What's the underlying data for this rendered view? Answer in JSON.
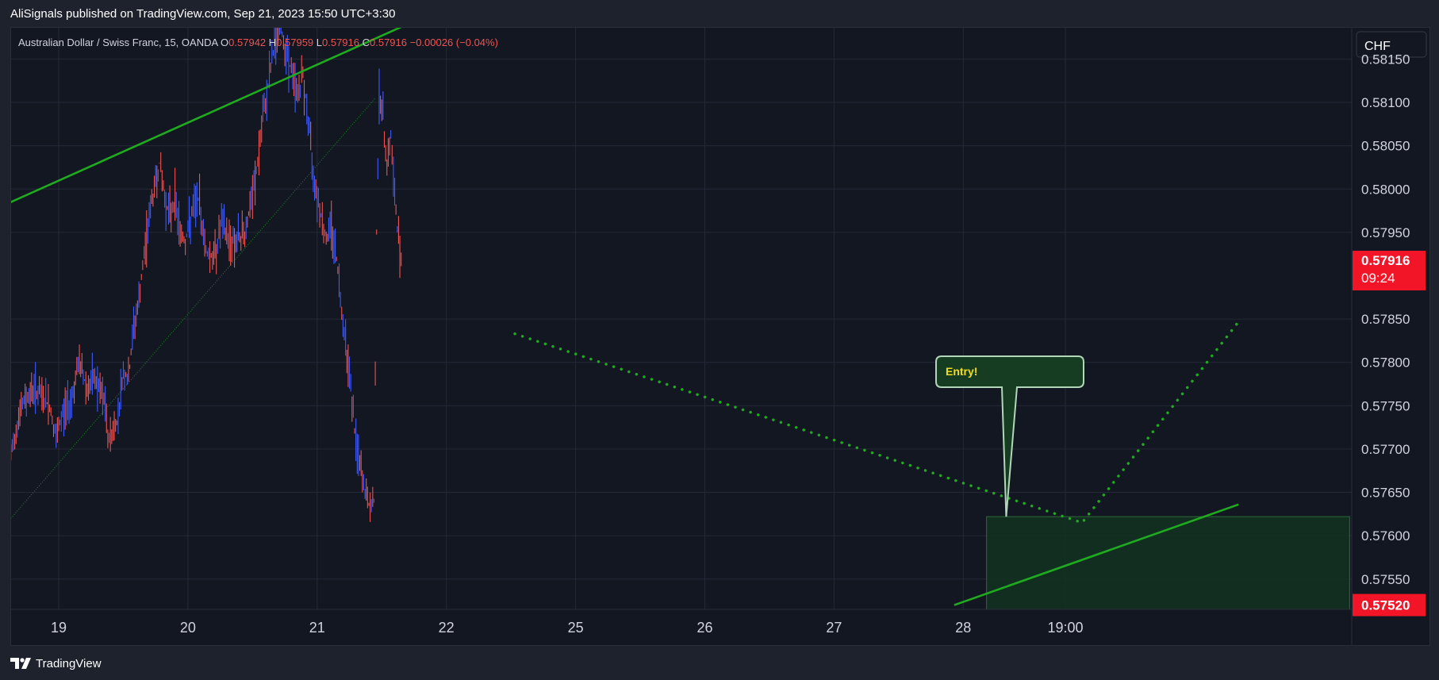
{
  "header": {
    "published_by": "AliSignals published on TradingView.com, Sep 21, 2023 15:50 UTC+3:30"
  },
  "footer": {
    "brand": "TradingView"
  },
  "colors": {
    "background": "#131722",
    "grid": "#242937",
    "up_candle": "#3d5afe",
    "down_candle": "#ef5350",
    "trendline": "#1faa1f",
    "price_tag": "#f21528",
    "callout_fill": "#163d21",
    "callout_border": "#b2d6b8",
    "callout_text": "#f2dc1f",
    "zone_fill": "#123320"
  },
  "chart_data": {
    "type": "line",
    "symbol": "Australian Dollar / Swiss Franc, 15, OANDA",
    "ohlc": {
      "o_label": "O",
      "o": "0.57942",
      "h_label": "H",
      "h": "0.57959",
      "l_label": "L",
      "l": "0.57916",
      "c_label": "C",
      "c": "0.57916",
      "change": "−0.00026 (−0.04%)"
    },
    "currency_button": "CHF",
    "y_axis": {
      "ticks": [
        "0.58150",
        "0.58100",
        "0.58050",
        "0.58000",
        "0.57950",
        "0.57850",
        "0.57800",
        "0.57750",
        "0.57700",
        "0.57650",
        "0.57600",
        "0.57550"
      ],
      "tick_values": [
        0.5815,
        0.581,
        0.5805,
        0.58,
        0.5795,
        0.5785,
        0.578,
        0.5775,
        0.577,
        0.5765,
        0.576,
        0.5755
      ],
      "range": [
        0.57515,
        0.58187
      ]
    },
    "x_axis": {
      "ticks": [
        "19",
        "20",
        "21",
        "22",
        "25",
        "26",
        "27",
        "28",
        "19:00"
      ],
      "tick_positions": [
        0,
        1,
        2,
        3,
        4,
        5,
        6,
        7,
        7.79
      ]
    },
    "current_price": {
      "label": "0.57916",
      "countdown": "09:24",
      "value": 0.57916
    },
    "level_price": {
      "label": "0.57520",
      "value": 0.5752
    },
    "price_series": [
      {
        "t": -0.37,
        "v": 0.5769
      },
      {
        "t": -0.31,
        "v": 0.5774
      },
      {
        "t": -0.25,
        "v": 0.5776
      },
      {
        "t": -0.19,
        "v": 0.5777
      },
      {
        "t": -0.13,
        "v": 0.5776
      },
      {
        "t": -0.07,
        "v": 0.5775
      },
      {
        "t": -0.02,
        "v": 0.5771
      },
      {
        "t": 0.03,
        "v": 0.5774
      },
      {
        "t": 0.1,
        "v": 0.5776
      },
      {
        "t": 0.16,
        "v": 0.578
      },
      {
        "t": 0.22,
        "v": 0.5777
      },
      {
        "t": 0.28,
        "v": 0.5778
      },
      {
        "t": 0.36,
        "v": 0.5775
      },
      {
        "t": 0.38,
        "v": 0.5771
      },
      {
        "t": 0.45,
        "v": 0.5773
      },
      {
        "t": 0.5,
        "v": 0.5779
      },
      {
        "t": 0.54,
        "v": 0.5778
      },
      {
        "t": 0.58,
        "v": 0.5784
      },
      {
        "t": 0.62,
        "v": 0.5787
      },
      {
        "t": 0.66,
        "v": 0.5792
      },
      {
        "t": 0.7,
        "v": 0.5797
      },
      {
        "t": 0.74,
        "v": 0.58
      },
      {
        "t": 0.78,
        "v": 0.5803
      },
      {
        "t": 0.82,
        "v": 0.5799
      },
      {
        "t": 0.86,
        "v": 0.5797
      },
      {
        "t": 0.9,
        "v": 0.5799
      },
      {
        "t": 0.94,
        "v": 0.5795
      },
      {
        "t": 0.98,
        "v": 0.5794
      },
      {
        "t": 1.03,
        "v": 0.5797
      },
      {
        "t": 1.08,
        "v": 0.5799
      },
      {
        "t": 1.14,
        "v": 0.5793
      },
      {
        "t": 1.2,
        "v": 0.5792
      },
      {
        "t": 1.26,
        "v": 0.5796
      },
      {
        "t": 1.32,
        "v": 0.5794
      },
      {
        "t": 1.38,
        "v": 0.5794
      },
      {
        "t": 1.44,
        "v": 0.5795
      },
      {
        "t": 1.5,
        "v": 0.5799
      },
      {
        "t": 1.54,
        "v": 0.5803
      },
      {
        "t": 1.58,
        "v": 0.5808
      },
      {
        "t": 1.62,
        "v": 0.5812
      },
      {
        "t": 1.66,
        "v": 0.5816
      },
      {
        "t": 1.71,
        "v": 0.5819
      },
      {
        "t": 1.76,
        "v": 0.5816
      },
      {
        "t": 1.81,
        "v": 0.5813
      },
      {
        "t": 1.85,
        "v": 0.5811
      },
      {
        "t": 1.89,
        "v": 0.5813
      },
      {
        "t": 1.93,
        "v": 0.5808
      },
      {
        "t": 1.97,
        "v": 0.5802
      },
      {
        "t": 2.02,
        "v": 0.5798
      },
      {
        "t": 2.07,
        "v": 0.5794
      },
      {
        "t": 2.11,
        "v": 0.5796
      },
      {
        "t": 2.15,
        "v": 0.5792
      },
      {
        "t": 2.2,
        "v": 0.5785
      },
      {
        "t": 2.25,
        "v": 0.5779
      },
      {
        "t": 2.29,
        "v": 0.5772
      },
      {
        "t": 2.33,
        "v": 0.5768
      },
      {
        "t": 2.37,
        "v": 0.5765
      },
      {
        "t": 2.41,
        "v": 0.5763
      },
      {
        "t": 2.44,
        "v": 0.5764
      },
      {
        "t": 2.46,
        "v": 0.5795
      },
      {
        "t": 2.48,
        "v": 0.5811
      },
      {
        "t": 2.51,
        "v": 0.5808
      },
      {
        "t": 2.54,
        "v": 0.5803
      },
      {
        "t": 2.57,
        "v": 0.5806
      },
      {
        "t": 2.6,
        "v": 0.5799
      },
      {
        "t": 2.63,
        "v": 0.5794
      },
      {
        "t": 2.66,
        "v": 0.5792
      }
    ],
    "lines": [
      {
        "name": "upper-trendline",
        "style": "solid",
        "from": {
          "t": -0.37,
          "v": 0.57985
        },
        "to": {
          "t": 2.8,
          "v": 0.58197
        }
      },
      {
        "name": "lower-trendline",
        "style": "solid",
        "from": {
          "t": 6.93,
          "v": 0.5752
        },
        "to": {
          "t": 9.13,
          "v": 0.57636
        }
      },
      {
        "name": "thin-channel-line",
        "style": "thin-dotted",
        "from": {
          "t": -0.37,
          "v": 0.5762
        },
        "to": {
          "t": 2.45,
          "v": 0.58105
        }
      }
    ],
    "projection": {
      "style": "dotted",
      "points": [
        {
          "t": 3.53,
          "v": 0.57833
        },
        {
          "t": 7.92,
          "v": 0.57615
        },
        {
          "t": 9.12,
          "v": 0.57845
        }
      ]
    },
    "zone": {
      "t1": 7.18,
      "t2": 9.99,
      "top": 0.57622,
      "bottom": 0.57515
    },
    "callout": {
      "label": "Entry!",
      "anchor": {
        "t": 7.32,
        "v": 0.57622
      }
    }
  }
}
